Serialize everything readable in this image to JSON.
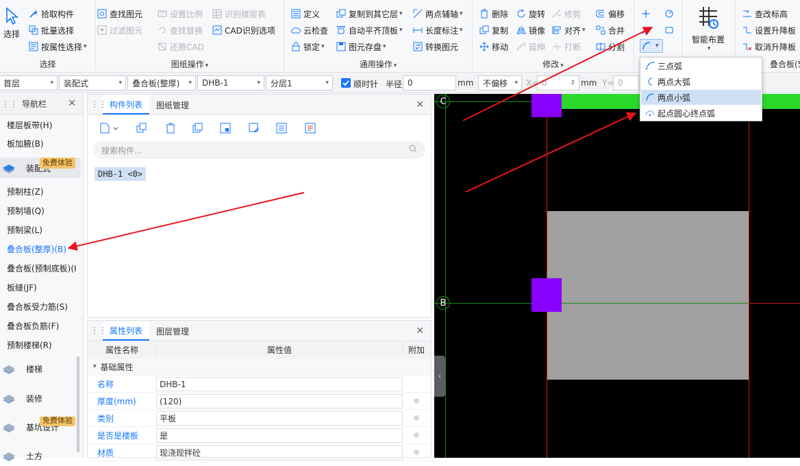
{
  "ribbon": {
    "select_group": {
      "select_label": "选择",
      "pick": "拾取构件",
      "batch": "批量选择",
      "by_attr": "按属性选择",
      "title": "选择"
    },
    "drawing_group": {
      "find": "查找图元",
      "filter": "过滤图元",
      "set_ratio": "设置比例",
      "find_replace": "查找替换",
      "restore_cad": "还原CAD",
      "identify_floor": "识别楼层表",
      "cad_options": "CAD识别选项",
      "title": "图纸操作"
    },
    "general_group": {
      "define": "定义",
      "cloud_check": "云检查",
      "lock": "锁定",
      "copy_to_layer": "复制到其它层",
      "auto_align": "自动平齐顶板",
      "save_element": "图元存盘",
      "two_point_axis": "两点辅轴",
      "length_mark": "长度标注",
      "convert_element": "转换图元",
      "title": "通用操作"
    },
    "modify_group": {
      "delete": "删除",
      "copy": "复制",
      "move": "移动",
      "rotate": "旋转",
      "mirror": "镜像",
      "extend": "延伸",
      "trim": "修剪",
      "align": "对齐",
      "break": "打断",
      "offset": "偏移",
      "merge": "合并",
      "split": "分割",
      "title": "修改"
    },
    "smart": {
      "label": "智能布置"
    },
    "elevation_group": {
      "check_elev": "查改标高",
      "set_lift": "设置升降板",
      "cancel_lift": "取消升降板",
      "title": "叠合板(5"
    }
  },
  "arc_menu": {
    "items": [
      "三点弧",
      "两点大弧",
      "两点小弧",
      "起点圆心终点弧"
    ]
  },
  "propbar": {
    "floor": "首层",
    "type": "装配式",
    "category": "叠合板(整厚)",
    "name": "DHB-1",
    "layer": "分层1",
    "clockwise": "顺时针",
    "radius_label": "半径",
    "radius": "0",
    "unit_mm": "mm",
    "offset": "不偏移",
    "x_label": "X=",
    "x_value": "0",
    "unit_mm2": "mm",
    "y_label": "Y=",
    "y_value": "0"
  },
  "nav": {
    "title": "导航栏",
    "items": [
      "楼层板带(H)",
      "板加腋(B)",
      "预制柱(Z)",
      "预制墙(Q)",
      "预制梁(L)",
      "叠合板(整厚)(B)",
      "叠合板(预制底板)(I",
      "板缝(JF)",
      "叠合板受力筋(S)",
      "叠合板负筋(F)",
      "预制楼梯(R)"
    ],
    "groups": [
      "装配式",
      "楼梯",
      "装修",
      "基坑设计",
      "土方"
    ],
    "badge": "免费体验"
  },
  "component_panel": {
    "tab1": "构件列表",
    "tab2": "图纸管理",
    "search_placeholder": "搜索构件...",
    "item": "DHB-1 <0>"
  },
  "attr_panel": {
    "tab1": "属性列表",
    "tab2": "图层管理",
    "headers": [
      "属性名称",
      "属性值",
      "附加"
    ],
    "section": "基础属性",
    "rows": [
      {
        "name": "名称",
        "value": "DHB-1"
      },
      {
        "name": "厚度(mm)",
        "value": "(120)"
      },
      {
        "name": "类别",
        "value": "平板"
      },
      {
        "name": "是否是楼板",
        "value": "是"
      },
      {
        "name": "材质",
        "value": "现浇现拌砼"
      }
    ]
  },
  "cad": {
    "axis_c": "C",
    "axis_b": "B"
  },
  "colors": {
    "accent": "#1677ff",
    "purple": "#8a00ff",
    "green": "#2bd92b",
    "gray": "#a0a0a0",
    "arrow": "#e8141c"
  }
}
